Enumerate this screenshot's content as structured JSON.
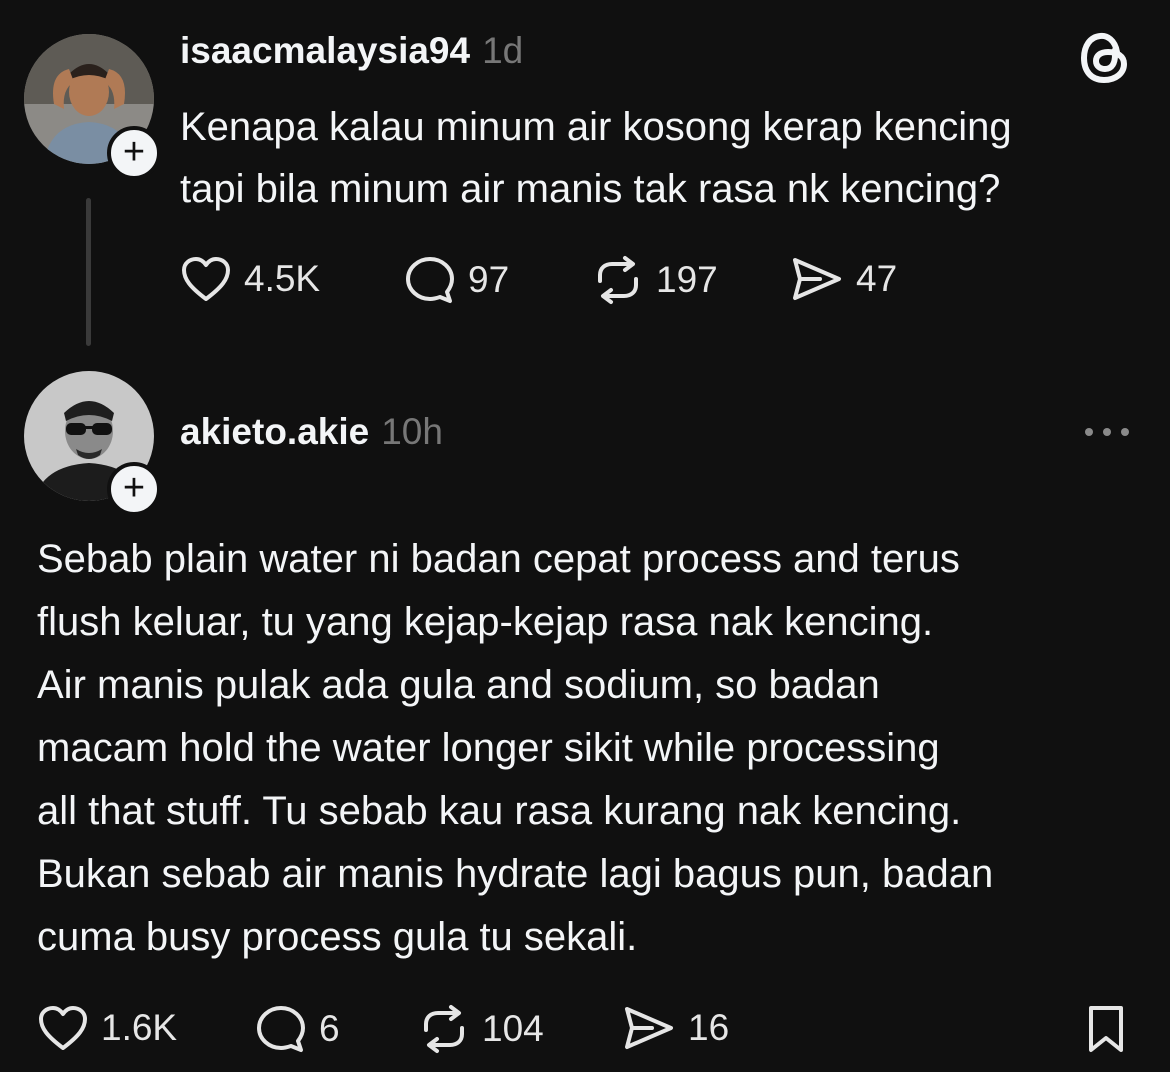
{
  "app": {
    "logo_icon": "threads-logo-icon",
    "accent": "#f3f5f7",
    "background": "#101010"
  },
  "post": {
    "username": "isaacmalaysia94",
    "time": "1d",
    "text": "Kenapa kalau minum air kosong kerap kencing\ntapi bila minum air manis tak rasa nk kencing?",
    "actions": {
      "likes": "4.5K",
      "replies": "97",
      "reposts": "197",
      "shares": "47"
    },
    "follow_label": "+"
  },
  "reply": {
    "username": "akieto.akie",
    "time": "10h",
    "more_icon": "more-horizontal-icon",
    "text": "Sebab plain water ni badan cepat process and terus\nflush keluar, tu yang kejap-kejap rasa nak kencing.\nAir manis pulak ada gula and sodium, so badan\nmacam hold the water longer sikit while processing\nall that stuff. Tu sebab kau rasa kurang nak kencing.\nBukan sebab air manis hydrate lagi bagus pun, badan\ncuma busy process gula tu sekali.",
    "actions": {
      "likes": "1.6K",
      "replies": "6",
      "reposts": "104",
      "shares": "16"
    },
    "follow_label": "+"
  }
}
